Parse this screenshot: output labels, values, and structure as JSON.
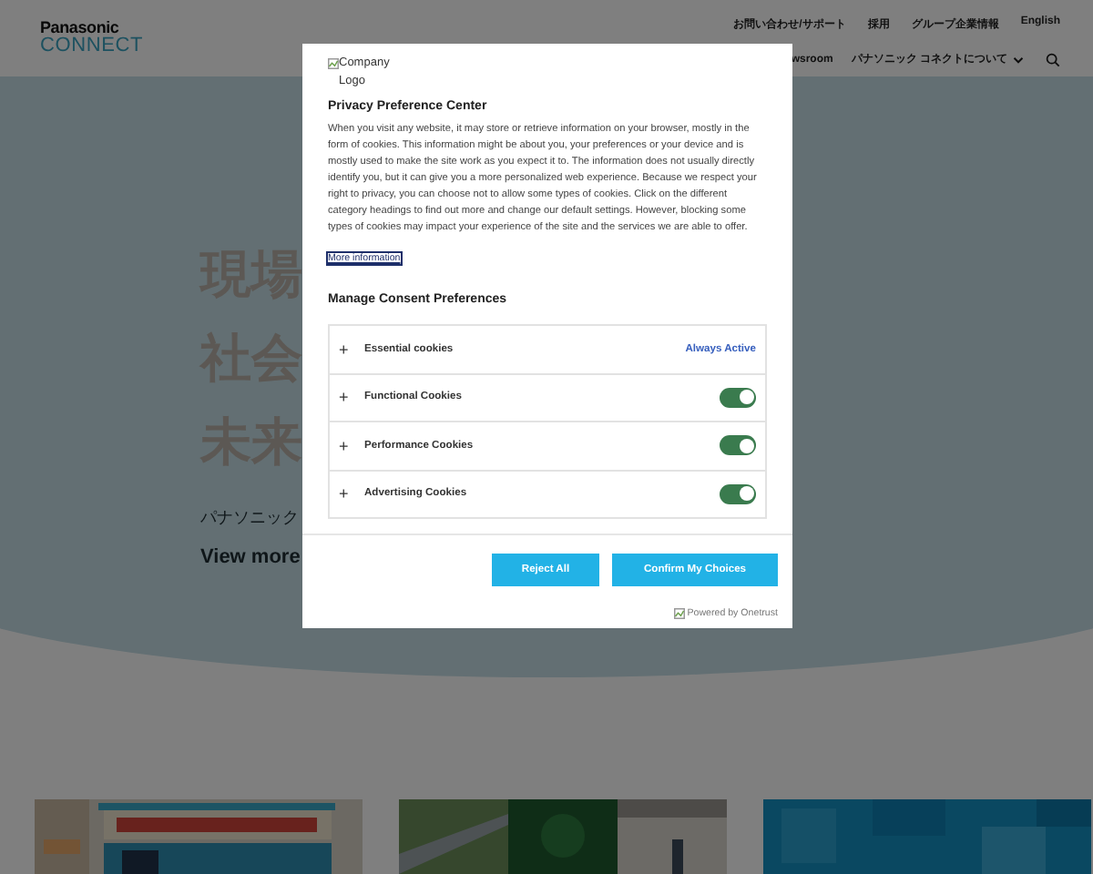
{
  "header": {
    "logo": {
      "brand": "Panasonic",
      "sub": "CONNECT"
    },
    "top_links": [
      "お問い合わせ/サポート",
      "採用",
      "グループ企業情報",
      "English"
    ],
    "main_nav": [
      {
        "label": "wsroom",
        "dropdown": false
      },
      {
        "label": "パナソニック コネクトについて",
        "dropdown": true
      }
    ]
  },
  "hero": {
    "headlines": [
      "現場",
      "社会",
      "未来"
    ],
    "subtitle": "パナソニック",
    "link": "View more"
  },
  "dialog": {
    "logo_alt": "Company Logo",
    "title": "Privacy Preference Center",
    "description": "When you visit any website, it may store or retrieve information on your browser, mostly in the form of cookies. This information might be about you, your preferences or your device and is mostly used to make the site work as you expect it to. The information does not usually directly identify you, but it can give you a more personalized web experience. Because we respect your right to privacy, you can choose not to allow some types of cookies. Click on the different category headings to find out more and change our default settings. However, blocking some types of cookies may impact your experience of the site and the services we are able to offer.",
    "more_link": "More information",
    "section_title": "Manage Consent Preferences",
    "categories": [
      {
        "expand": "+",
        "name": "Essential cookies",
        "kind": "status",
        "status": "Always Active"
      },
      {
        "expand": "+",
        "name": "Functional Cookies",
        "kind": "toggle",
        "on": true
      },
      {
        "expand": "+",
        "name": "Performance Cookies",
        "kind": "toggle",
        "on": true
      },
      {
        "expand": "+",
        "name": "Advertising Cookies",
        "kind": "toggle",
        "on": true
      }
    ],
    "buttons": [
      "Reject All",
      "Confirm My Choices"
    ],
    "powered_by": "Powered by Onetrust"
  }
}
